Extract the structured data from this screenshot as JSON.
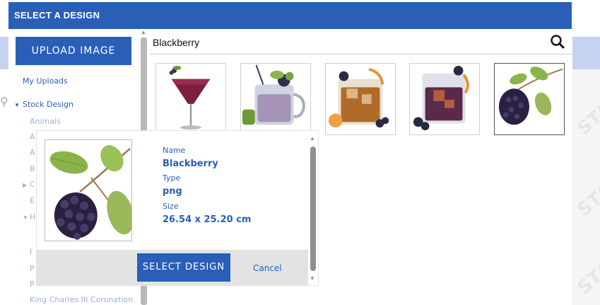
{
  "header": {
    "title": "SELECT A DESIGN"
  },
  "sidebar": {
    "upload_label": "UPLOAD IMAGE",
    "my_uploads": "My Uploads",
    "stock_design": "Stock Design",
    "items": [
      "Animals",
      "A",
      "A",
      "B",
      "C",
      "E",
      "H",
      "I",
      "P",
      "P",
      "King Charles III Coronation"
    ]
  },
  "search": {
    "value": "Blackberry"
  },
  "thumbnails": [
    {
      "name": "cocktail-martini"
    },
    {
      "name": "cocktail-mule"
    },
    {
      "name": "cocktail-old-fashioned-orange"
    },
    {
      "name": "cocktail-old-fashioned-blackberry"
    },
    {
      "name": "blackberry"
    }
  ],
  "detail": {
    "name_label": "Name",
    "name_value": "Blackberry",
    "type_label": "Type",
    "type_value": "png",
    "size_label": "Size",
    "size_value": "26.54 x 25.20 cm",
    "select_label": "SELECT DESIGN",
    "cancel_label": "Cancel"
  },
  "background": {
    "watermark": "STAHLS"
  },
  "colors": {
    "primary": "#2a5fb8",
    "header_bg": "#2a5fb8",
    "footer_bg": "#e3e3e3",
    "sub_text": "#9fb0d6"
  }
}
